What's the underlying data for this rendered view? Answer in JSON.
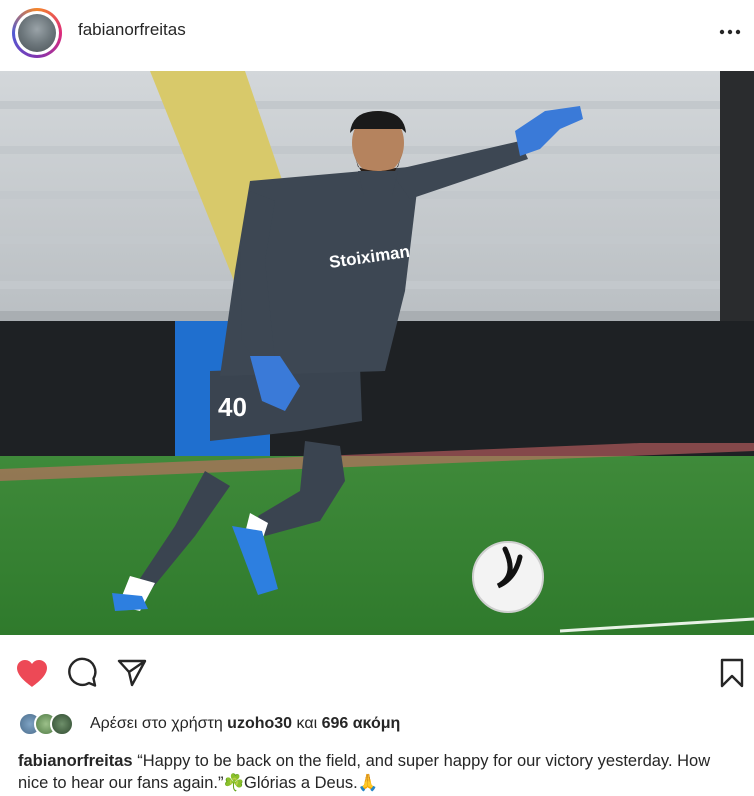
{
  "post": {
    "username": "fabianorfreitas",
    "photo_alt": ""
  },
  "icons": {
    "more": "more-options-icon",
    "like": "heart-icon",
    "comment": "comment-icon",
    "share": "share-icon",
    "save": "bookmark-icon",
    "heart_color": "#ed4956"
  },
  "likes": {
    "prefix": "Αρέσει στο χρήστη",
    "user": "uzoho30",
    "joiner": "και",
    "count": "696 ακόμη"
  },
  "caption": {
    "username": "fabianorfreitas",
    "text": " “Happy to be back on the field, and super happy for our victory yesterday. How nice to hear our fans again.”☘️Glórias a Deus.🙏"
  }
}
